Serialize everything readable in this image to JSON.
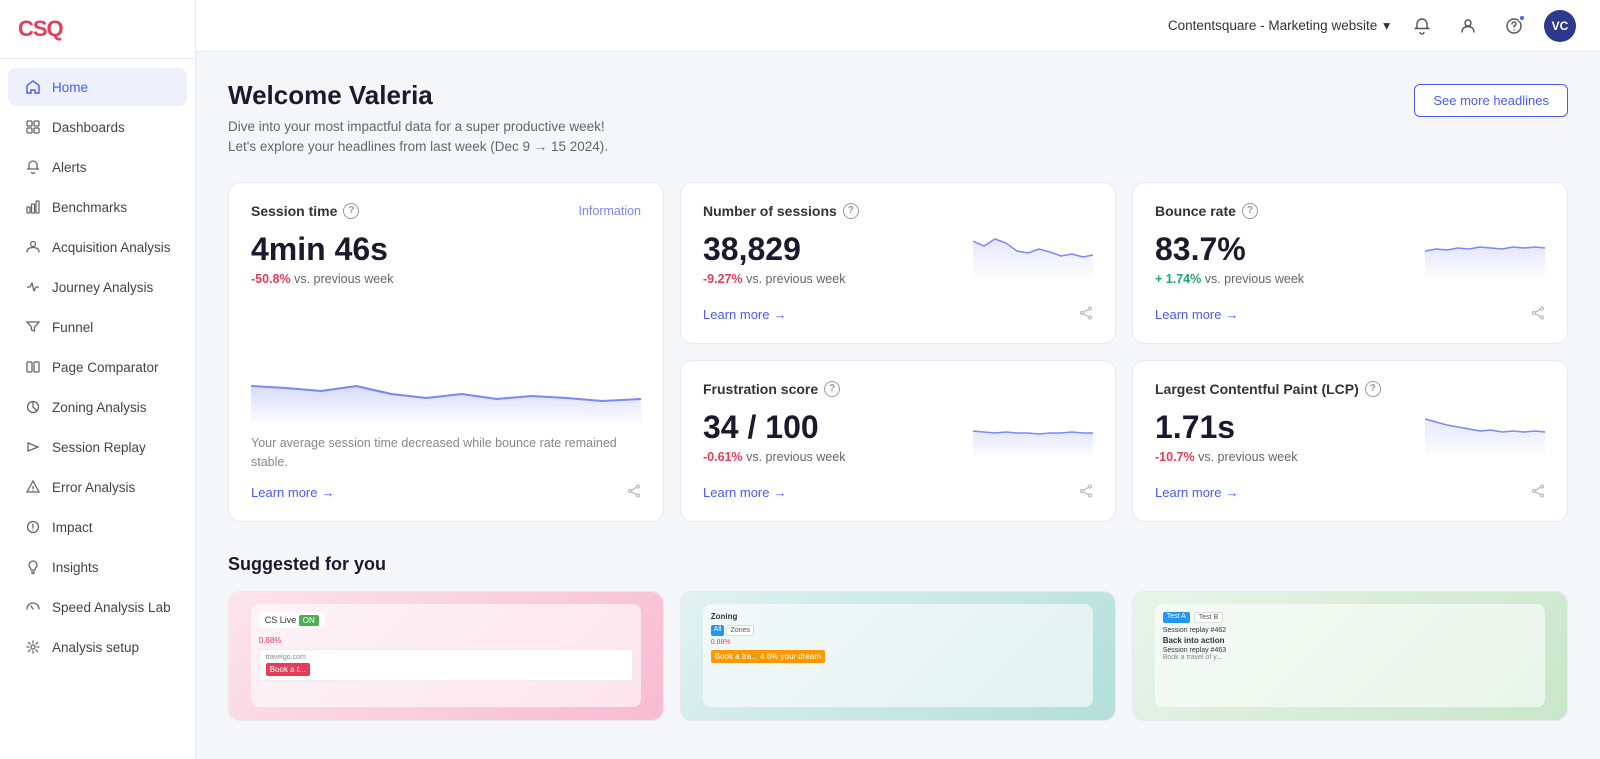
{
  "brand": {
    "logo": "CSQ",
    "logo_color": "#e63c5a"
  },
  "topbar": {
    "workspace": "Contentsquare - Marketing website",
    "avatar_initials": "VC"
  },
  "sidebar": {
    "items": [
      {
        "id": "home",
        "label": "Home",
        "active": true,
        "icon": "home"
      },
      {
        "id": "dashboards",
        "label": "Dashboards",
        "active": false,
        "icon": "grid"
      },
      {
        "id": "alerts",
        "label": "Alerts",
        "active": false,
        "icon": "bell"
      },
      {
        "id": "benchmarks",
        "label": "Benchmarks",
        "active": false,
        "icon": "bar"
      },
      {
        "id": "acquisition",
        "label": "Acquisition Analysis",
        "active": false,
        "icon": "user"
      },
      {
        "id": "journey",
        "label": "Journey Analysis",
        "active": false,
        "icon": "path"
      },
      {
        "id": "funnel",
        "label": "Funnel",
        "active": false,
        "icon": "funnel"
      },
      {
        "id": "page-comparator",
        "label": "Page Comparator",
        "active": false,
        "icon": "compare"
      },
      {
        "id": "zoning",
        "label": "Zoning Analysis",
        "active": false,
        "icon": "zoning"
      },
      {
        "id": "session-replay",
        "label": "Session Replay",
        "active": false,
        "icon": "replay"
      },
      {
        "id": "error-analysis",
        "label": "Error Analysis",
        "active": false,
        "icon": "error"
      },
      {
        "id": "impact",
        "label": "Impact",
        "active": false,
        "icon": "impact"
      },
      {
        "id": "insights",
        "label": "Insights",
        "active": false,
        "icon": "insights"
      },
      {
        "id": "speed-lab",
        "label": "Speed Analysis Lab",
        "active": false,
        "icon": "speed"
      },
      {
        "id": "analysis-setup",
        "label": "Analysis setup",
        "active": false,
        "icon": "setup"
      }
    ]
  },
  "welcome": {
    "title": "Welcome Valeria",
    "subtitle_line1": "Dive into your most impactful data for a super productive week!",
    "subtitle_line2": "Let's explore your headlines from last week (Dec 9 → 15 2024).",
    "see_more_label": "See more headlines"
  },
  "metrics": [
    {
      "id": "session-time",
      "title": "Session time",
      "value": "4min 46s",
      "change": "-50.8%",
      "change_type": "neg",
      "change_suffix": "vs. previous week",
      "description": "Your average session time decreased while bounce rate remained stable.",
      "learn_more": "Learn more",
      "is_tall": true,
      "sparkline": [
        55,
        50,
        48,
        52,
        47,
        44,
        46,
        43,
        45,
        44,
        42,
        43
      ],
      "info_link": "Information"
    },
    {
      "id": "num-sessions",
      "title": "Number of sessions",
      "value": "38,829",
      "change": "-9.27%",
      "change_type": "neg",
      "change_suffix": "vs. previous week",
      "learn_more": "Learn more",
      "is_tall": false,
      "sparkline": [
        70,
        65,
        72,
        68,
        60,
        58,
        62,
        59,
        55,
        57,
        54,
        56
      ]
    },
    {
      "id": "bounce-rate",
      "title": "Bounce rate",
      "value": "83.7%",
      "change": "+ 1.74%",
      "change_type": "pos",
      "change_suffix": "vs. previous week",
      "learn_more": "Learn more",
      "is_tall": false,
      "sparkline": [
        80,
        82,
        81,
        83,
        82,
        84,
        83,
        82,
        84,
        83,
        84,
        83
      ]
    },
    {
      "id": "frustration",
      "title": "Frustration score",
      "value": "34 / 100",
      "change": "-0.61%",
      "change_type": "neg",
      "change_suffix": "vs. previous week",
      "learn_more": "Learn more",
      "is_tall": false,
      "sparkline": [
        36,
        35,
        34,
        35,
        34,
        34,
        33,
        34,
        34,
        35,
        34,
        34
      ]
    },
    {
      "id": "lcp",
      "title": "Largest Contentful Paint (LCP)",
      "value": "1.71s",
      "change": "-10.7%",
      "change_type": "neg",
      "change_suffix": "vs. previous week",
      "learn_more": "Learn more",
      "is_tall": false,
      "sparkline": [
        1.9,
        1.85,
        1.8,
        1.78,
        1.75,
        1.72,
        1.74,
        1.71,
        1.73,
        1.71,
        1.72,
        1.71
      ]
    }
  ],
  "suggested": {
    "title": "Suggested for you",
    "cards": [
      {
        "id": "card-1",
        "preview_class": "preview-pink",
        "label": "CS Live session preview"
      },
      {
        "id": "card-2",
        "preview_class": "preview-teal",
        "label": "Zoning analysis preview"
      },
      {
        "id": "card-3",
        "preview_class": "preview-green",
        "label": "Session replay comparison"
      }
    ]
  }
}
